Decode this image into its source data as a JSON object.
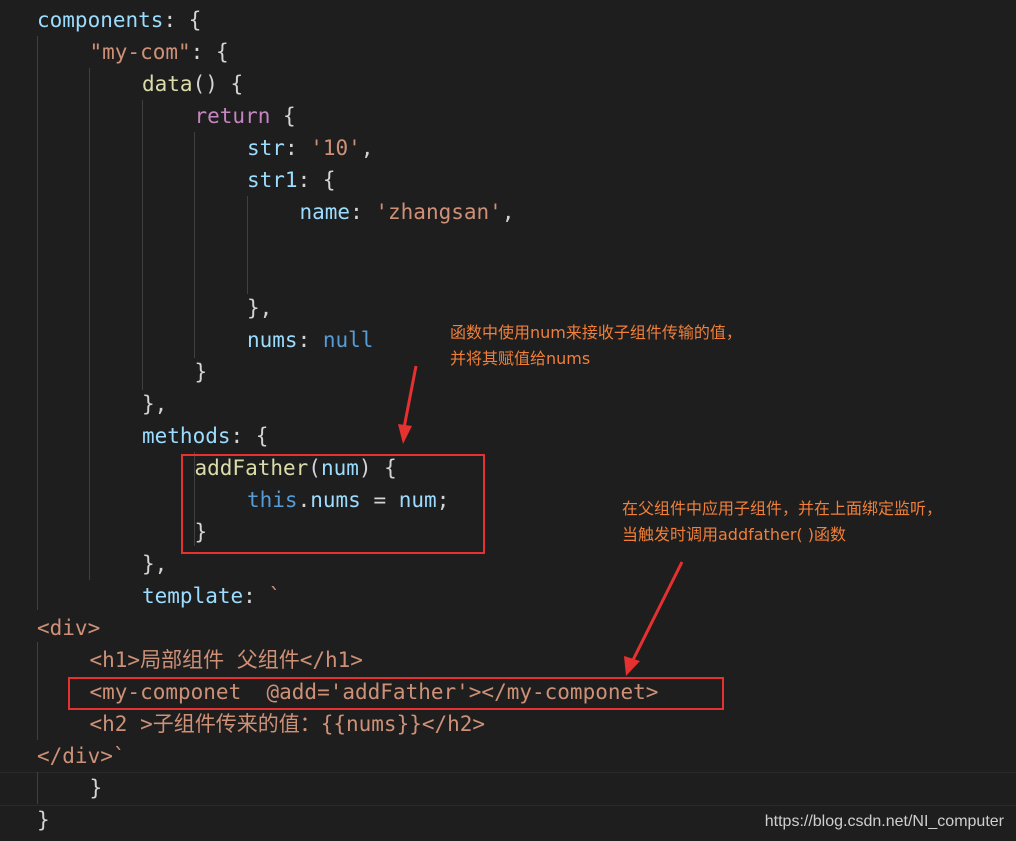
{
  "code": {
    "lines": [
      {
        "indent": 0,
        "tokens": [
          {
            "t": "components",
            "c": "prop"
          },
          {
            "t": ": {",
            "c": "punct"
          }
        ]
      },
      {
        "indent": 1,
        "tokens": [
          {
            "t": "\"my-com\"",
            "c": "str"
          },
          {
            "t": ": {",
            "c": "punct"
          }
        ]
      },
      {
        "indent": 2,
        "tokens": [
          {
            "t": "data",
            "c": "fn"
          },
          {
            "t": "() {",
            "c": "punct"
          }
        ]
      },
      {
        "indent": 3,
        "tokens": [
          {
            "t": "return",
            "c": "kw"
          },
          {
            "t": " {",
            "c": "punct"
          }
        ]
      },
      {
        "indent": 4,
        "tokens": [
          {
            "t": "str",
            "c": "prop"
          },
          {
            "t": ": ",
            "c": "punct"
          },
          {
            "t": "'10'",
            "c": "str"
          },
          {
            "t": ",",
            "c": "punct"
          }
        ]
      },
      {
        "indent": 4,
        "tokens": [
          {
            "t": "str1",
            "c": "prop"
          },
          {
            "t": ": {",
            "c": "punct"
          }
        ]
      },
      {
        "indent": 5,
        "tokens": [
          {
            "t": "name",
            "c": "prop"
          },
          {
            "t": ": ",
            "c": "punct"
          },
          {
            "t": "'zhangsan'",
            "c": "str"
          },
          {
            "t": ",",
            "c": "punct"
          }
        ]
      },
      {
        "indent": 0,
        "tokens": []
      },
      {
        "indent": 0,
        "tokens": []
      },
      {
        "indent": 4,
        "tokens": [
          {
            "t": "},",
            "c": "punct"
          }
        ]
      },
      {
        "indent": 4,
        "tokens": [
          {
            "t": "nums",
            "c": "prop"
          },
          {
            "t": ": ",
            "c": "punct"
          },
          {
            "t": "null",
            "c": "blue"
          }
        ]
      },
      {
        "indent": 3,
        "tokens": [
          {
            "t": "}",
            "c": "punct"
          }
        ]
      },
      {
        "indent": 2,
        "tokens": [
          {
            "t": "},",
            "c": "punct"
          }
        ]
      },
      {
        "indent": 2,
        "tokens": [
          {
            "t": "methods",
            "c": "prop"
          },
          {
            "t": ": {",
            "c": "punct"
          }
        ]
      },
      {
        "indent": 3,
        "tokens": [
          {
            "t": "addFather",
            "c": "fn"
          },
          {
            "t": "(",
            "c": "punct"
          },
          {
            "t": "num",
            "c": "prop"
          },
          {
            "t": ") {",
            "c": "punct"
          }
        ]
      },
      {
        "indent": 4,
        "tokens": [
          {
            "t": "this",
            "c": "blue"
          },
          {
            "t": ".",
            "c": "punct"
          },
          {
            "t": "nums",
            "c": "prop"
          },
          {
            "t": " = ",
            "c": "punct"
          },
          {
            "t": "num",
            "c": "prop"
          },
          {
            "t": ";",
            "c": "punct"
          }
        ]
      },
      {
        "indent": 3,
        "tokens": [
          {
            "t": "}",
            "c": "punct"
          }
        ]
      },
      {
        "indent": 2,
        "tokens": [
          {
            "t": "},",
            "c": "punct"
          }
        ]
      },
      {
        "indent": 2,
        "tokens": [
          {
            "t": "template",
            "c": "prop"
          },
          {
            "t": ": ",
            "c": "punct"
          },
          {
            "t": "`",
            "c": "tpl"
          }
        ]
      },
      {
        "indent": 0,
        "tokens": [
          {
            "t": "<div>",
            "c": "tpl"
          }
        ]
      },
      {
        "indent": 1,
        "tokens": [
          {
            "t": "<h1>局部组件 父组件</h1>",
            "c": "tpl"
          }
        ]
      },
      {
        "indent": 1,
        "tokens": [
          {
            "t": "<my-componet  @add='addFather'></my-componet>",
            "c": "tpl"
          }
        ]
      },
      {
        "indent": 1,
        "tokens": [
          {
            "t": "<h2 >子组件传来的值：{{nums}}</h2>",
            "c": "tpl"
          }
        ]
      },
      {
        "indent": 0,
        "tokens": [
          {
            "t": "</div>`",
            "c": "tpl"
          }
        ]
      },
      {
        "indent": 1,
        "tokens": [
          {
            "t": "}",
            "c": "punct"
          }
        ]
      },
      {
        "indent": 0,
        "tokens": [
          {
            "t": "}",
            "c": "punct"
          }
        ]
      }
    ]
  },
  "colors": {
    "background": "#1e1e1e",
    "property": "#9cdcfe",
    "string": "#ce9178",
    "function": "#dcdcaa",
    "keyword": "#c586c0",
    "constant": "#569cd6",
    "annotation_text": "#f07f3a",
    "annotation_box": "#e5312f"
  },
  "annotations": {
    "note_top": "函数中使用num来接收子组件传输的值，\n并将其赋值给nums",
    "note_bottom": "在父组件中应用子组件，并在上面绑定监听，\n当触发时调用addfather( )函数"
  },
  "watermark": "https://blog.csdn.net/NI_computer"
}
